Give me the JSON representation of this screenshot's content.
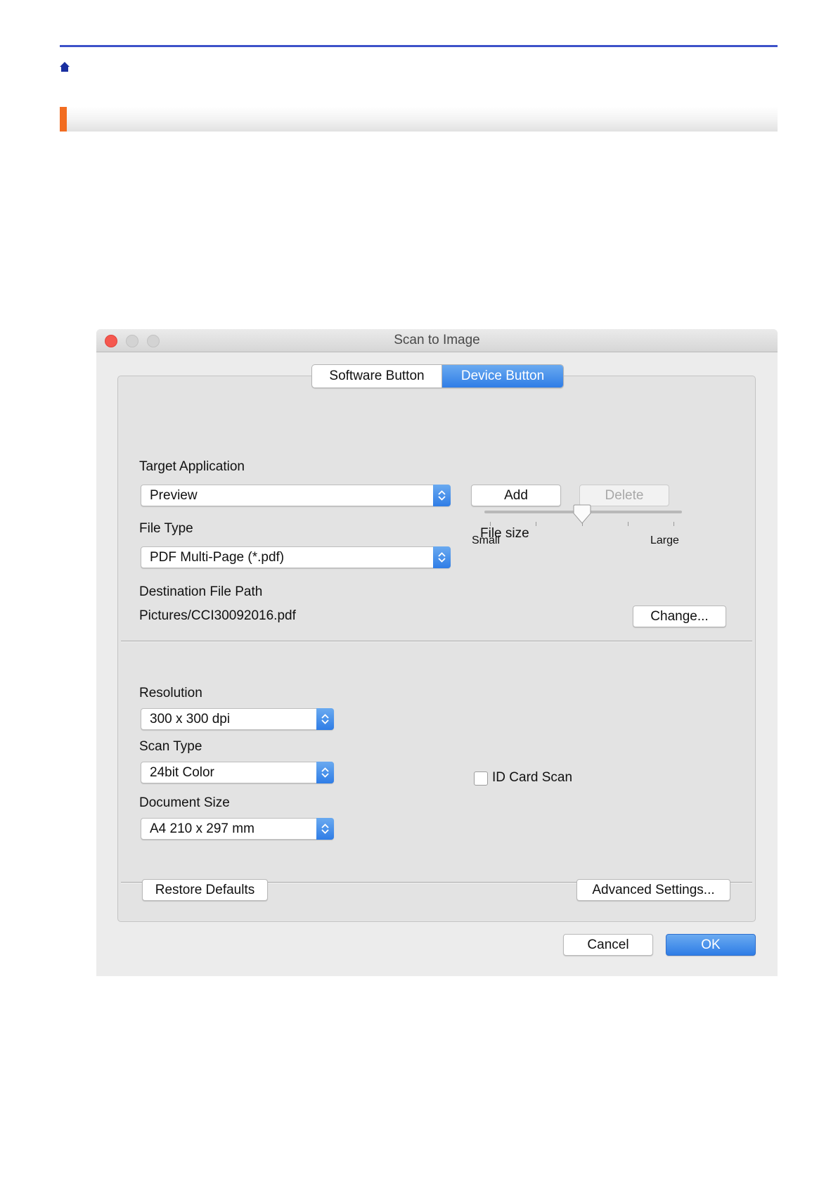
{
  "page": {
    "home_icon": "home-icon",
    "accent_color": "#f26d21",
    "rule_color": "#3d52c9"
  },
  "window": {
    "title": "Scan to Image",
    "tabs": [
      {
        "label": "Software Button",
        "active": false
      },
      {
        "label": "Device Button",
        "active": true
      }
    ],
    "target_application": {
      "label": "Target Application",
      "value": "Preview",
      "add_label": "Add",
      "delete_label": "Delete"
    },
    "file_type": {
      "label": "File Type",
      "value": "PDF Multi-Page (*.pdf)"
    },
    "file_size": {
      "label": "File size",
      "min_label": "Small",
      "max_label": "Large",
      "level": 0.5
    },
    "destination": {
      "label": "Destination File Path",
      "value": "Pictures/CCI30092016.pdf",
      "change_label": "Change..."
    },
    "resolution": {
      "label": "Resolution",
      "value": "300 x 300 dpi"
    },
    "scan_type": {
      "label": "Scan Type",
      "value": "24bit Color"
    },
    "document_size": {
      "label": "Document Size",
      "value": "A4 210 x 297 mm"
    },
    "id_card_scan": {
      "label": "ID Card Scan",
      "checked": false
    },
    "restore_label": "Restore Defaults",
    "advanced_label": "Advanced Settings...",
    "cancel_label": "Cancel",
    "ok_label": "OK"
  }
}
